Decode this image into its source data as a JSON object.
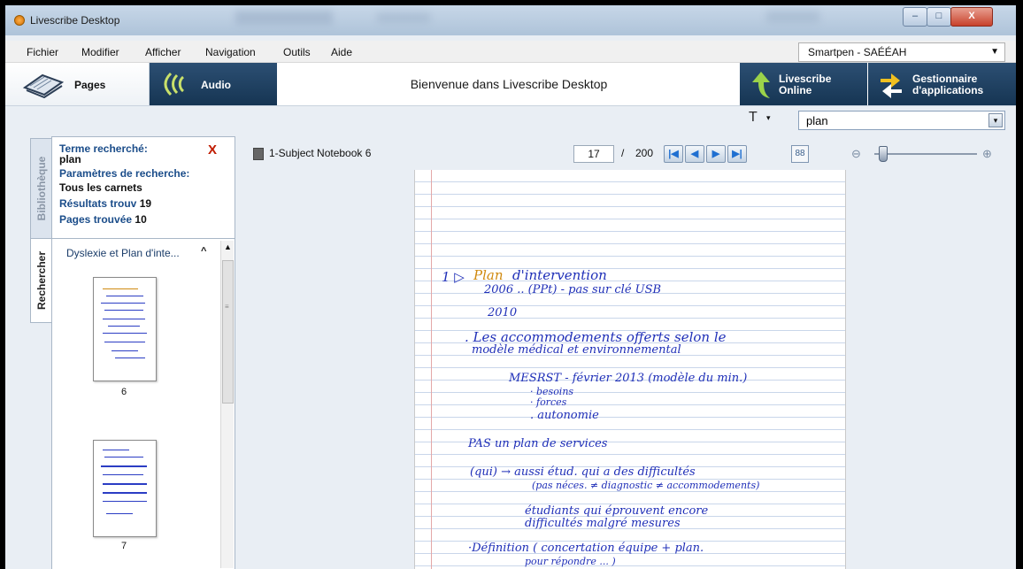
{
  "window": {
    "title": "Livescribe Desktop",
    "min": "–",
    "max": "□",
    "close": "X"
  },
  "menu": {
    "items": [
      "Fichier",
      "Modifier",
      "Afficher",
      "Navigation",
      "Outils",
      "Aide"
    ]
  },
  "smartpen": {
    "value": "Smartpen - SAÉÉAH",
    "arrow": "▼"
  },
  "toolbar": {
    "pages_label": "Pages",
    "audio_label": "Audio",
    "welcome": "Bienvenue dans Livescribe Desktop",
    "online_l1": "Livescribe",
    "online_l2": "Online",
    "apps_l1": "Gestionnaire",
    "apps_l2": "d'applications"
  },
  "search": {
    "font_icon": "T",
    "font_arrow": "▾",
    "value": "plan",
    "arrow": "▾"
  },
  "sidetabs": {
    "library": "Bibliothèque",
    "search": "Rechercher"
  },
  "results": {
    "term_label": "Terme recherché:",
    "term_value": "plan",
    "close": "X",
    "params_label": "Paramètres de recherche:",
    "params_value": "Tous les carnets",
    "results_label": "Résultats trouv",
    "results_value": "19",
    "pages_label": "Pages trouvée",
    "pages_value": "10",
    "notebook": "Dyslexie et Plan d'inte...",
    "caret": "^",
    "thumbs": [
      "6",
      "7"
    ]
  },
  "viewer": {
    "notebook_name": "1-Subject Notebook 6",
    "current_page": "17",
    "sep": "/",
    "total_pages": "200",
    "first": "|◀",
    "prev": "◀",
    "next": "▶",
    "last": "▶|",
    "zoom_out": "⊖",
    "zoom_in": "⊕",
    "zoom_level": 0.05
  },
  "notes": {
    "l1a": "1 ▷",
    "l1b": "Plan",
    "l1c": "d'intervention",
    "l2": "2006  ..  (PPt) - pas sur clé USB",
    "l3": "2010",
    "l4": ". Les accommodements offerts selon le",
    "l5": "modèle médical et environnemental",
    "l6": "MESRST - février 2013      (modèle du min.)",
    "l7": "· besoins",
    "l8": "· forces",
    "l9": ". autonomie",
    "l10": "PAS un plan de services",
    "l11": "(qui) →   aussi étud. qui a des difficultés",
    "l12": "(pas néces. ≠ diagnostic ≠ accommodements)",
    "l13": "étudiants qui éprouvent encore",
    "l14": "difficultés malgré mesures",
    "l15": "·Définition    ( concertation équipe + plan.",
    "l16": "pour répondre ... )"
  }
}
